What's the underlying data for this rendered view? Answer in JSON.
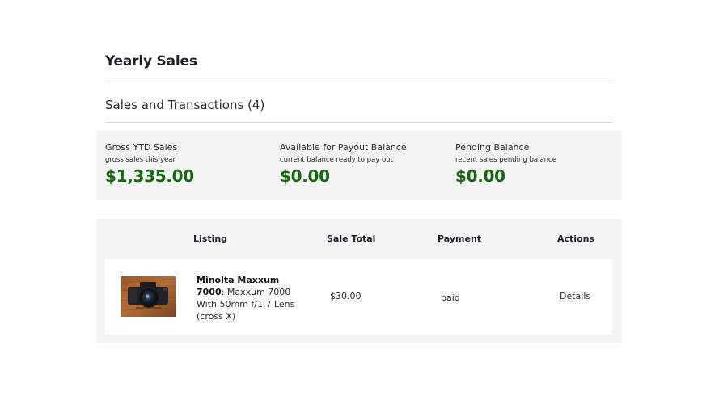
{
  "header": {
    "title": "Yearly Sales",
    "subtitle": "Sales and Transactions (4)"
  },
  "summary": [
    {
      "title": "Gross YTD Sales",
      "description": "gross sales this year",
      "amount": "$1,335.00"
    },
    {
      "title": "Available for Payout Balance",
      "description": "current balance ready to pay out",
      "amount": "$0.00"
    },
    {
      "title": "Pending Balance",
      "description": "recent sales pending balance",
      "amount": "$0.00"
    }
  ],
  "table": {
    "columns": [
      "Listing",
      "Sale Total",
      "Payment",
      "Actions"
    ],
    "rows": [
      {
        "listing_name": "Minolta Maxxum 7000",
        "listing_separator": ":",
        "listing_description": " Maxxum 7000 With 50mm f/1.7 Lens (cross X)",
        "sale_total": "$30.00",
        "payment": "paid",
        "action": "Details",
        "image_icon": "camera-photo-icon"
      }
    ]
  },
  "colors": {
    "amount_green": "#15690f",
    "panel_background": "#f4f4f4"
  }
}
